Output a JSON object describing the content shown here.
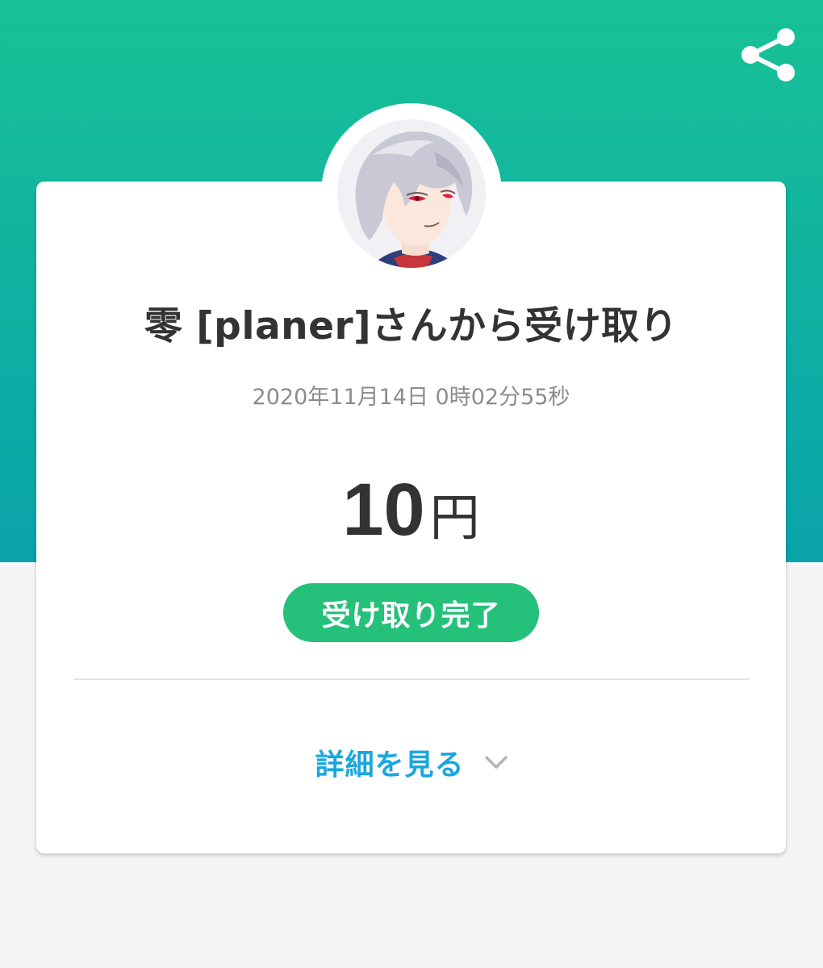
{
  "header": {
    "share_icon": "share-icon",
    "background_colors": [
      "#17c296",
      "#0aa3ab"
    ]
  },
  "receipt": {
    "avatar_icon": "user-avatar",
    "title": "零 [planer]さんから受け取り",
    "timestamp": "2020年11月14日 0時02分55秒",
    "amount_value": "10",
    "amount_unit": "円",
    "status_label": "受け取り完了",
    "status_color": "#25c07a"
  },
  "details": {
    "label": "詳細を見る",
    "icon": "chevron-down-icon",
    "color": "#1aa6e0"
  }
}
